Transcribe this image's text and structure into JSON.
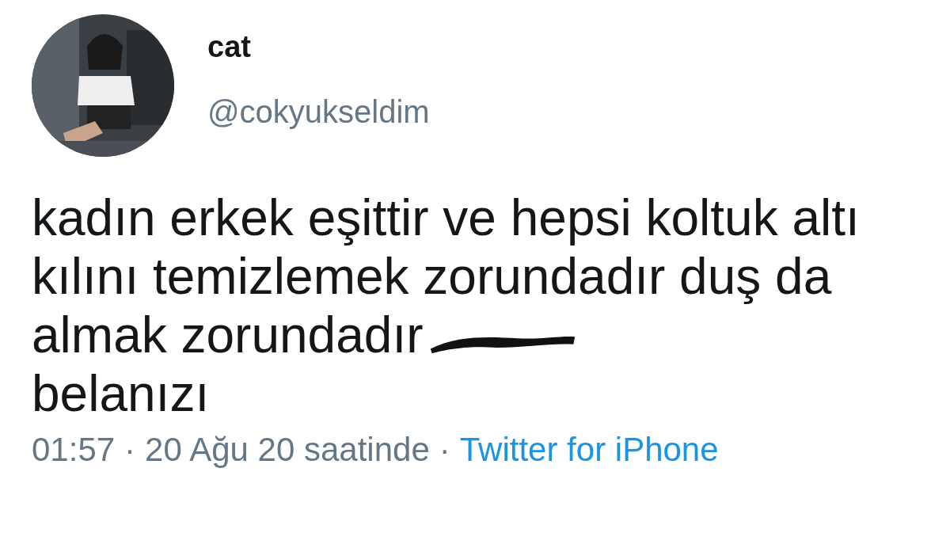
{
  "author": {
    "name": "cat",
    "handle": "@cokyukseldim"
  },
  "tweet": {
    "text_before_redaction": "kadın erkek eşittir ve hepsi koltuk altı kılını temizlemek zorundadır duş da almak zorundadır",
    "redacted": true,
    "text_after_redaction": "belanızı"
  },
  "footer": {
    "time": "01:57",
    "separator_1": "·",
    "date": "20 Ağu 20 saatinde",
    "separator_2": "·",
    "source": "Twitter for iPhone"
  }
}
